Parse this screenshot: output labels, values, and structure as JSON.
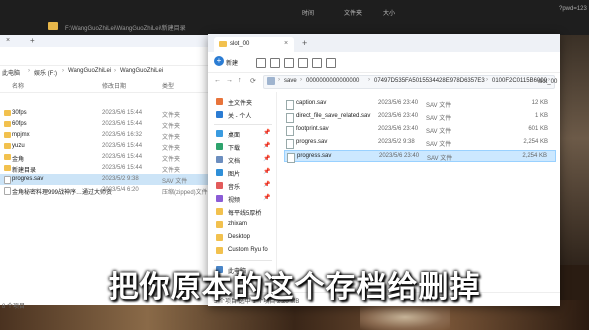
{
  "top_window": {
    "path": "F:\\WangGuoZhiLei\\WangGuoZhiLei\\新建目录",
    "col_modified": "时间",
    "col_type": "文件夹",
    "col_size": "大小",
    "url_fragment": "?pwd=123"
  },
  "left_window": {
    "breadcrumbs": [
      "此电脑",
      "娱乐 (F:)",
      "WangGuoZhiLei",
      "WangGuoZhiLei"
    ],
    "columns": [
      "名称",
      "修改日期",
      "类型"
    ],
    "rows": [
      {
        "name": "30fps",
        "date": "2023/5/6 15:44",
        "type": "文件夹",
        "icon": "folder-icon",
        "selected": false
      },
      {
        "name": "60fps",
        "date": "2023/5/6 15:44",
        "type": "文件夹",
        "icon": "folder-icon",
        "selected": false
      },
      {
        "name": "mpjmx",
        "date": "2023/5/6 16:32",
        "type": "文件夹",
        "icon": "folder-icon",
        "selected": false
      },
      {
        "name": "yuzu",
        "date": "2023/5/6 15:44",
        "type": "文件夹",
        "icon": "folder-icon",
        "selected": false
      },
      {
        "name": "金角",
        "date": "2023/5/6 15:44",
        "type": "文件夹",
        "icon": "folder-icon",
        "selected": false
      },
      {
        "name": "新建目录",
        "date": "2023/5/6 15:44",
        "type": "文件夹",
        "icon": "folder-icon",
        "selected": false
      },
      {
        "name": "progres.sav",
        "date": "2023/5/2 9:38",
        "type": "SAV 文件",
        "icon": "file-icon",
        "selected": true
      },
      {
        "name": "金角秘密料理999战神序…通过大师资",
        "date": "2023/5/4 6:20",
        "type": "压缩(zipped)文件",
        "icon": "zip-icon",
        "selected": false
      }
    ],
    "status": "8 个项目"
  },
  "main_window": {
    "tab_label": "slot_00",
    "new_button": "新建",
    "address": [
      "save",
      "0000000000000000",
      "07497D535FA5015534428E978D6357E3",
      "0100F2C0115B6000",
      "slot_00"
    ],
    "nav_items": [
      {
        "label": "主文件夹",
        "icon": "home-icon",
        "color": "#e8743b",
        "pinned": false
      },
      {
        "label": "关 - 个人",
        "icon": "cloud-icon",
        "color": "#2b7cd3",
        "pinned": false
      },
      {
        "label": "桌面",
        "icon": "desktop-icon",
        "color": "#3a9be0",
        "pinned": true
      },
      {
        "label": "下载",
        "icon": "download-icon",
        "color": "#2ea36d",
        "pinned": true
      },
      {
        "label": "文档",
        "icon": "documents-icon",
        "color": "#6c8ebf",
        "pinned": true
      },
      {
        "label": "图片",
        "icon": "pictures-icon",
        "color": "#2f8fd8",
        "pinned": true
      },
      {
        "label": "音乐",
        "icon": "music-icon",
        "color": "#e25b5b",
        "pinned": true
      },
      {
        "label": "视频",
        "icon": "videos-icon",
        "color": "#8b5cd6",
        "pinned": true
      },
      {
        "label": "每平线5厚桥",
        "icon": "folder-icon",
        "color": "#f2c14e",
        "pinned": false
      },
      {
        "label": "zhixam",
        "icon": "folder-icon",
        "color": "#f2c14e",
        "pinned": false
      },
      {
        "label": "Desktop",
        "icon": "folder-icon",
        "color": "#f2c14e",
        "pinned": false
      },
      {
        "label": "Custom Ryu fo",
        "icon": "folder-icon",
        "color": "#f2c14e",
        "pinned": false
      },
      {
        "label": "此电脑",
        "icon": "pc-icon",
        "color": "#4a86c8",
        "pinned": false
      }
    ],
    "files": [
      {
        "name": "caption.sav",
        "date": "2023/5/6 23:40",
        "type": "SAV 文件",
        "size": "12 KB",
        "selected": false
      },
      {
        "name": "direct_file_save_related.sav",
        "date": "2023/5/6 23:40",
        "type": "SAV 文件",
        "size": "1 KB",
        "selected": false
      },
      {
        "name": "footprint.sav",
        "date": "2023/5/6 23:40",
        "type": "SAV 文件",
        "size": "601 KB",
        "selected": false
      },
      {
        "name": "progres.sav",
        "date": "2023/5/2 9:38",
        "type": "SAV 文件",
        "size": "2,254 KB",
        "selected": false
      },
      {
        "name": "progress.sav",
        "date": "2023/5/6 23:40",
        "type": "SAV 文件",
        "size": "2,254 KB",
        "selected": true
      }
    ],
    "status": "5 个项目  选中 1 个项目 2.20 MB"
  },
  "subtitle": "把你原本的这个存档给删掉"
}
